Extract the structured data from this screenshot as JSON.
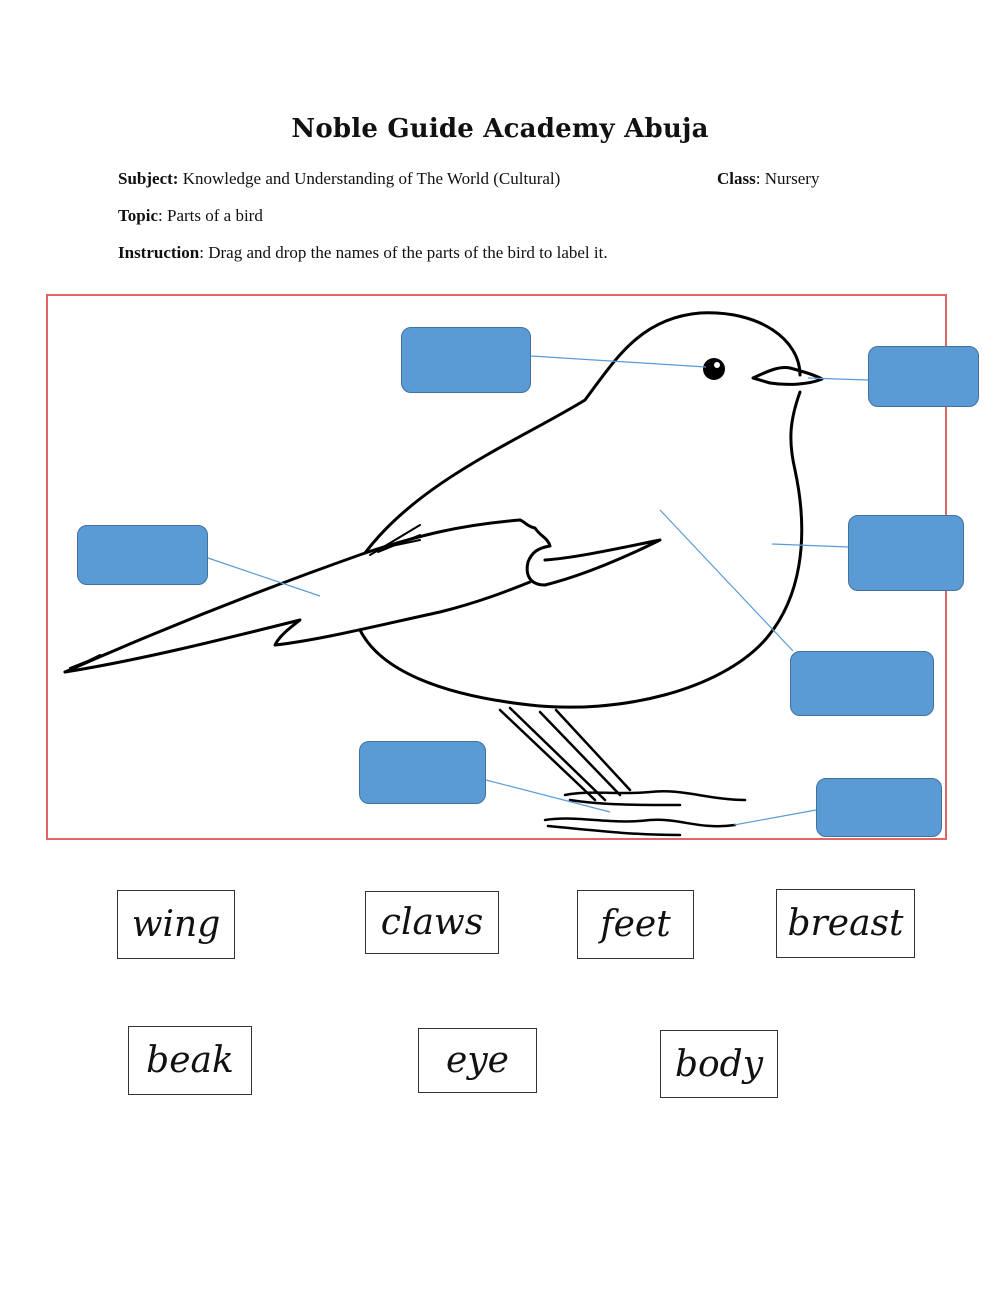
{
  "header": {
    "title": "Noble Guide Academy Abuja",
    "subject_label": "Subject:",
    "subject_value": " Knowledge and Understanding of The World (Cultural)",
    "class_label": "Class",
    "class_value": ": Nursery",
    "topic_label": "Topic",
    "topic_value": ": Parts of a bird",
    "instruction_label": "Instruction",
    "instruction_value": ": Drag and drop the names of the parts of the bird to label it."
  },
  "diagram": {
    "frame_color": "#e06666",
    "drop_zone_color": "#5b9bd5",
    "leader_line_color": "#5b9bd5",
    "drop_zones": [
      {
        "target": "eye"
      },
      {
        "target": "beak"
      },
      {
        "target": "wing"
      },
      {
        "target": "breast"
      },
      {
        "target": "body"
      },
      {
        "target": "claws"
      },
      {
        "target": "feet"
      }
    ]
  },
  "word_bank": [
    {
      "label": "wing"
    },
    {
      "label": "claws"
    },
    {
      "label": "feet"
    },
    {
      "label": "breast"
    },
    {
      "label": "beak"
    },
    {
      "label": "eye"
    },
    {
      "label": "body"
    }
  ]
}
